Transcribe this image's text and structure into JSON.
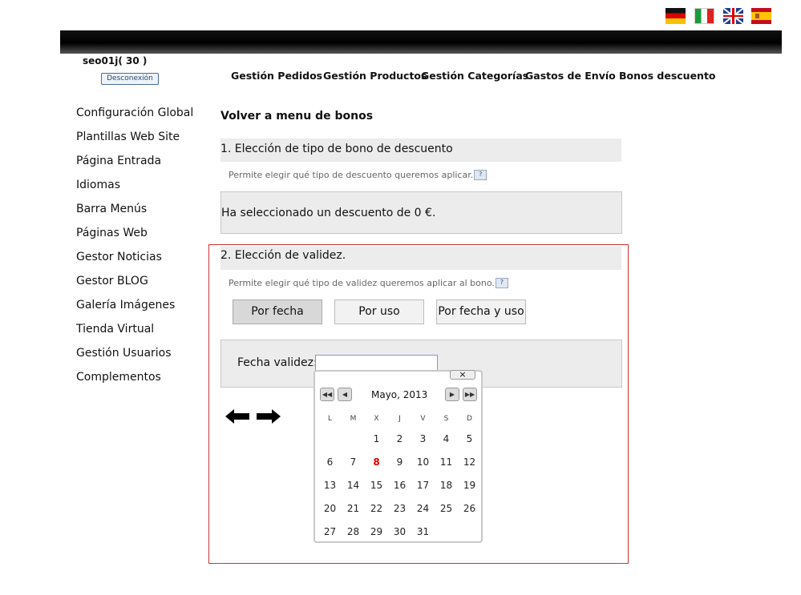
{
  "flags": [
    "Deutsch",
    "Italiano",
    "English",
    "Español"
  ],
  "header": {
    "user": "seo01j( 30 )",
    "logout_label": "Desconexión"
  },
  "nav": [
    "Gestión Pedidos",
    "Gestión Productos",
    "Gestión Categorías",
    "Gastos de Envío",
    "Bonos descuento"
  ],
  "sidebar": [
    "Configuración Global",
    "Plantillas Web Site",
    "Página Entrada",
    "Idiomas",
    "Barra Menús",
    "Páginas Web",
    "Gestor Noticias",
    "Gestor BLOG",
    "Galería Imágenes",
    "Tienda Virtual",
    "Gestión Usuarios",
    "Complementos"
  ],
  "main": {
    "back_link": "Volver a menu de bonos",
    "step1": {
      "title": "1. Elección de tipo de bono de descuento",
      "hint": "Permite elegir qué tipo de descuento queremos aplicar.",
      "selected": "Ha seleccionado un descuento de 0 €."
    },
    "step2": {
      "title": "2. Elección de validez.",
      "hint": "Permite elegir qué tipo de validez queremos aplicar al bono.",
      "buttons": [
        "Por fecha",
        "Por uso",
        "Por fecha y uso"
      ],
      "active_button": 0,
      "date_label": "Fecha validez:",
      "date_value": ""
    }
  },
  "calendar": {
    "close_label": "×",
    "month_title": "Mayo, 2013",
    "weekdays": [
      "L",
      "M",
      "X",
      "J",
      "V",
      "S",
      "D"
    ],
    "weeks": [
      [
        "",
        "",
        "1",
        "2",
        "3",
        "4",
        "5"
      ],
      [
        "6",
        "7",
        "8",
        "9",
        "10",
        "11",
        "12"
      ],
      [
        "13",
        "14",
        "15",
        "16",
        "17",
        "18",
        "19"
      ],
      [
        "20",
        "21",
        "22",
        "23",
        "24",
        "25",
        "26"
      ],
      [
        "27",
        "28",
        "29",
        "30",
        "31",
        "",
        ""
      ]
    ],
    "today": "8",
    "today_color": "#dd0000"
  },
  "colors": {
    "accent_border": "#cc3333",
    "panel_bg": "#ececec"
  }
}
